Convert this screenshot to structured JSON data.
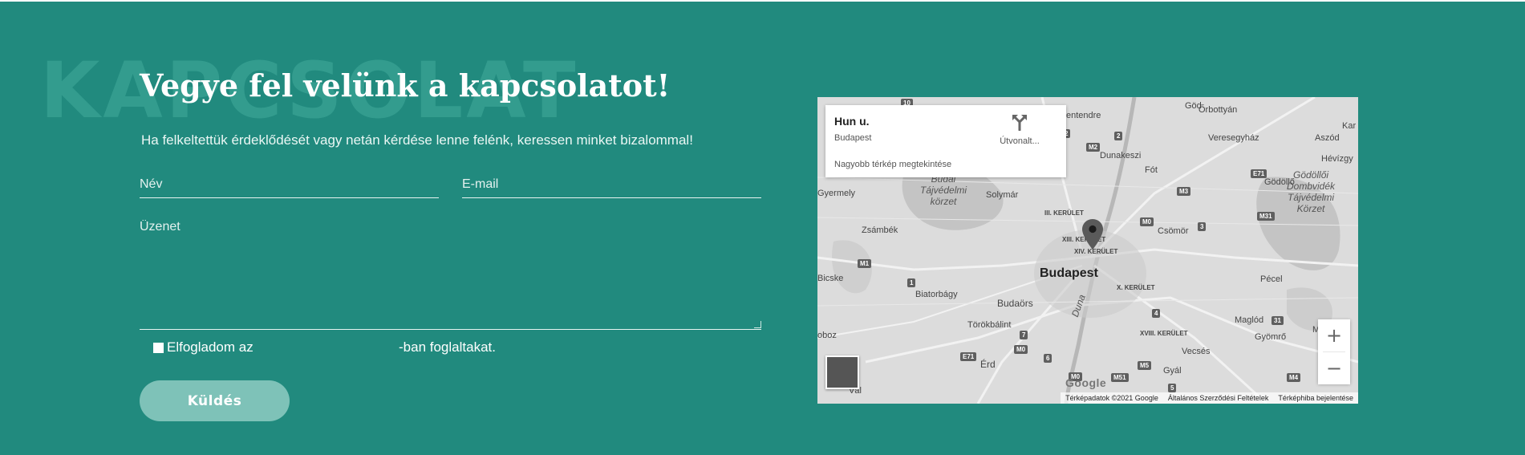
{
  "section": {
    "watermark": "KAPCSOLAT",
    "title": "Vegye fel velünk a kapcsolatot!",
    "subtitle": "Ha felkeltettük érdeklődését vagy netán kérdése lenne felénk, keressen minket bizalommal!"
  },
  "form": {
    "name_placeholder": "Név",
    "email_placeholder": "E-mail",
    "message_placeholder": "Üzenet",
    "consent_text": "Elfogladom az",
    "consent_tail": "-ban foglaltakat.",
    "submit_label": "Küldés"
  },
  "map": {
    "place_title": "Hun u.",
    "place_address": "Budapest",
    "directions_label": "Útvonalt...",
    "larger_map_link": "Nagyobb térkép megtekintése",
    "zoom_in": "+",
    "zoom_out": "−",
    "google_logo": "Google",
    "footer": {
      "data": "Térképadatok ©2021 Google",
      "terms": "Általános Szerződési Feltételek",
      "report": "Térképhiba bejelentése"
    },
    "labels": {
      "god": "Göd",
      "orbottyan": "Őrbottyán",
      "szentendre": "entendre",
      "karo": "Kar",
      "veresegyhaz": "Veresegyház",
      "aszod": "Aszód",
      "dunakeszi": "Dunakeszi",
      "hevizgy": "Hévízgy",
      "fot": "Fót",
      "godollo": "Gödöllő",
      "gyermely": "Gyermely",
      "solymar": "Solymár",
      "budai": "Budai\nTájvédelmi\nkörzet",
      "godolloi": "Gödöllői\nDombvidék\nTájvédelmi\nKörzet",
      "kerulet3": "III. KERÜLET",
      "zsambek": "Zsámbék",
      "csomor": "Csömör",
      "kerulet13": "XIII. KERÜLET",
      "kerulet14": "XIV. KERÜLET",
      "budapest": "Budapest",
      "bicske": "Bicske",
      "pecel": "Pécel",
      "biatorbagy": "Biatorbágy",
      "kerulet10": "X. KERÜLET",
      "budaors": "Budaörs",
      "duna": "Duna",
      "torokbalint": "Törökbálint",
      "kerulet18": "XVIII. KERÜLET",
      "oboz": "oboz",
      "maglod": "Maglód",
      "gyomro": "Gyömrő",
      "menc": "Menc",
      "erd": "Érd",
      "vecses": "Vecsés",
      "val": "Vál",
      "gyal": "Gyál"
    },
    "shields": [
      "10",
      "2",
      "2",
      "M2",
      "E71",
      "M3",
      "M31",
      "M0",
      "3",
      "M1",
      "1",
      "7",
      "4",
      "M0",
      "6",
      "E71",
      "M0",
      "M51",
      "M5",
      "31",
      "M4",
      "5"
    ]
  },
  "colors": {
    "background": "#218a7e",
    "button": "#7ec2b8",
    "watermark": "#3ca596"
  }
}
